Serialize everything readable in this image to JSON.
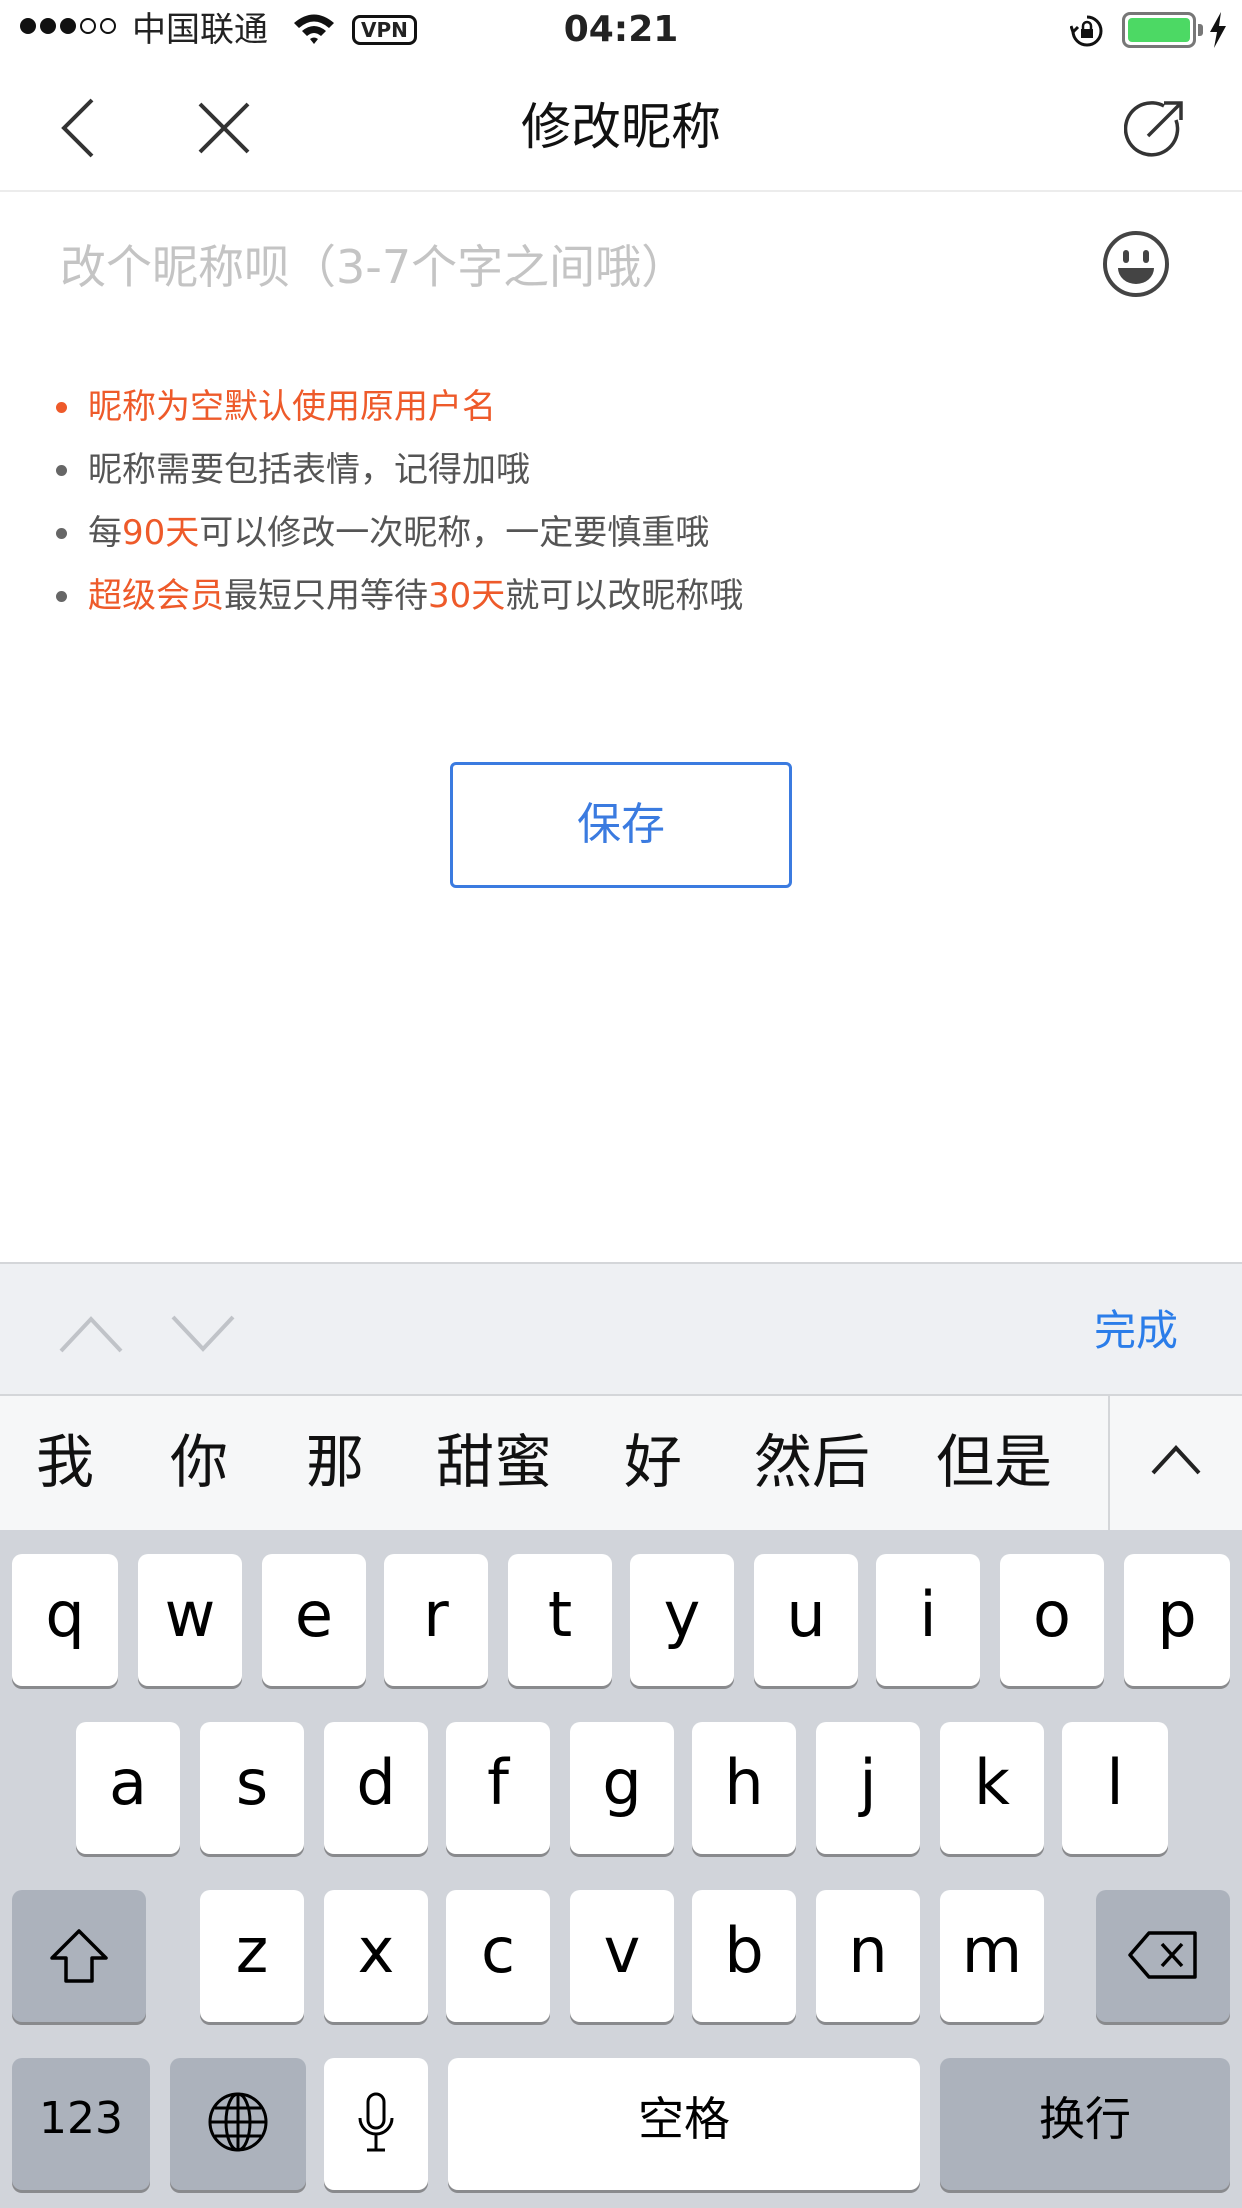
{
  "status_bar": {
    "carrier": "中国联通",
    "vpn": "VPN",
    "time": "04:21",
    "signal_bars_filled": 3,
    "signal_bars_total": 5,
    "battery_level": 1.0,
    "battery_color": "#4cd964"
  },
  "navbar": {
    "title": "修改昵称",
    "icons": [
      "back-icon",
      "close-icon",
      "share-icon"
    ]
  },
  "input": {
    "placeholder": "改个昵称呗（3-7个字之间哦）",
    "value": "",
    "emoji_icon": "emoji-icon"
  },
  "tips": [
    {
      "parts": [
        {
          "text": "昵称为空默认使用原用户名",
          "highlight": true
        }
      ],
      "bullet_highlight": true
    },
    {
      "parts": [
        {
          "text": "昵称需要包括表情，记得加哦",
          "highlight": false
        }
      ],
      "bullet_highlight": false
    },
    {
      "parts": [
        {
          "text": "每",
          "highlight": false
        },
        {
          "text": "90天",
          "highlight": true
        },
        {
          "text": "可以修改一次昵称，一定要慎重哦",
          "highlight": false
        }
      ],
      "bullet_highlight": false
    },
    {
      "parts": [
        {
          "text": "超级会员",
          "highlight": true
        },
        {
          "text": "最短只用等待",
          "highlight": false
        },
        {
          "text": "30天",
          "highlight": true
        },
        {
          "text": "就可以改昵称哦",
          "highlight": false
        }
      ],
      "bullet_highlight": false
    }
  ],
  "save_button": {
    "label": "保存"
  },
  "keyboard_toolbar": {
    "done_label": "完成"
  },
  "candidates": [
    "我",
    "你",
    "那",
    "甜蜜",
    "好",
    "然后",
    "但是"
  ],
  "keyboard": {
    "row1": [
      "q",
      "w",
      "e",
      "r",
      "t",
      "y",
      "u",
      "i",
      "o",
      "p"
    ],
    "row2": [
      "a",
      "s",
      "d",
      "f",
      "g",
      "h",
      "j",
      "k",
      "l"
    ],
    "row3": [
      "z",
      "x",
      "c",
      "v",
      "b",
      "n",
      "m"
    ],
    "numbers_label": "123",
    "space_label": "空格",
    "return_label": "换行"
  },
  "colors": {
    "accent_blue": "#3b7be0",
    "highlight_orange": "#ee5a2a"
  }
}
